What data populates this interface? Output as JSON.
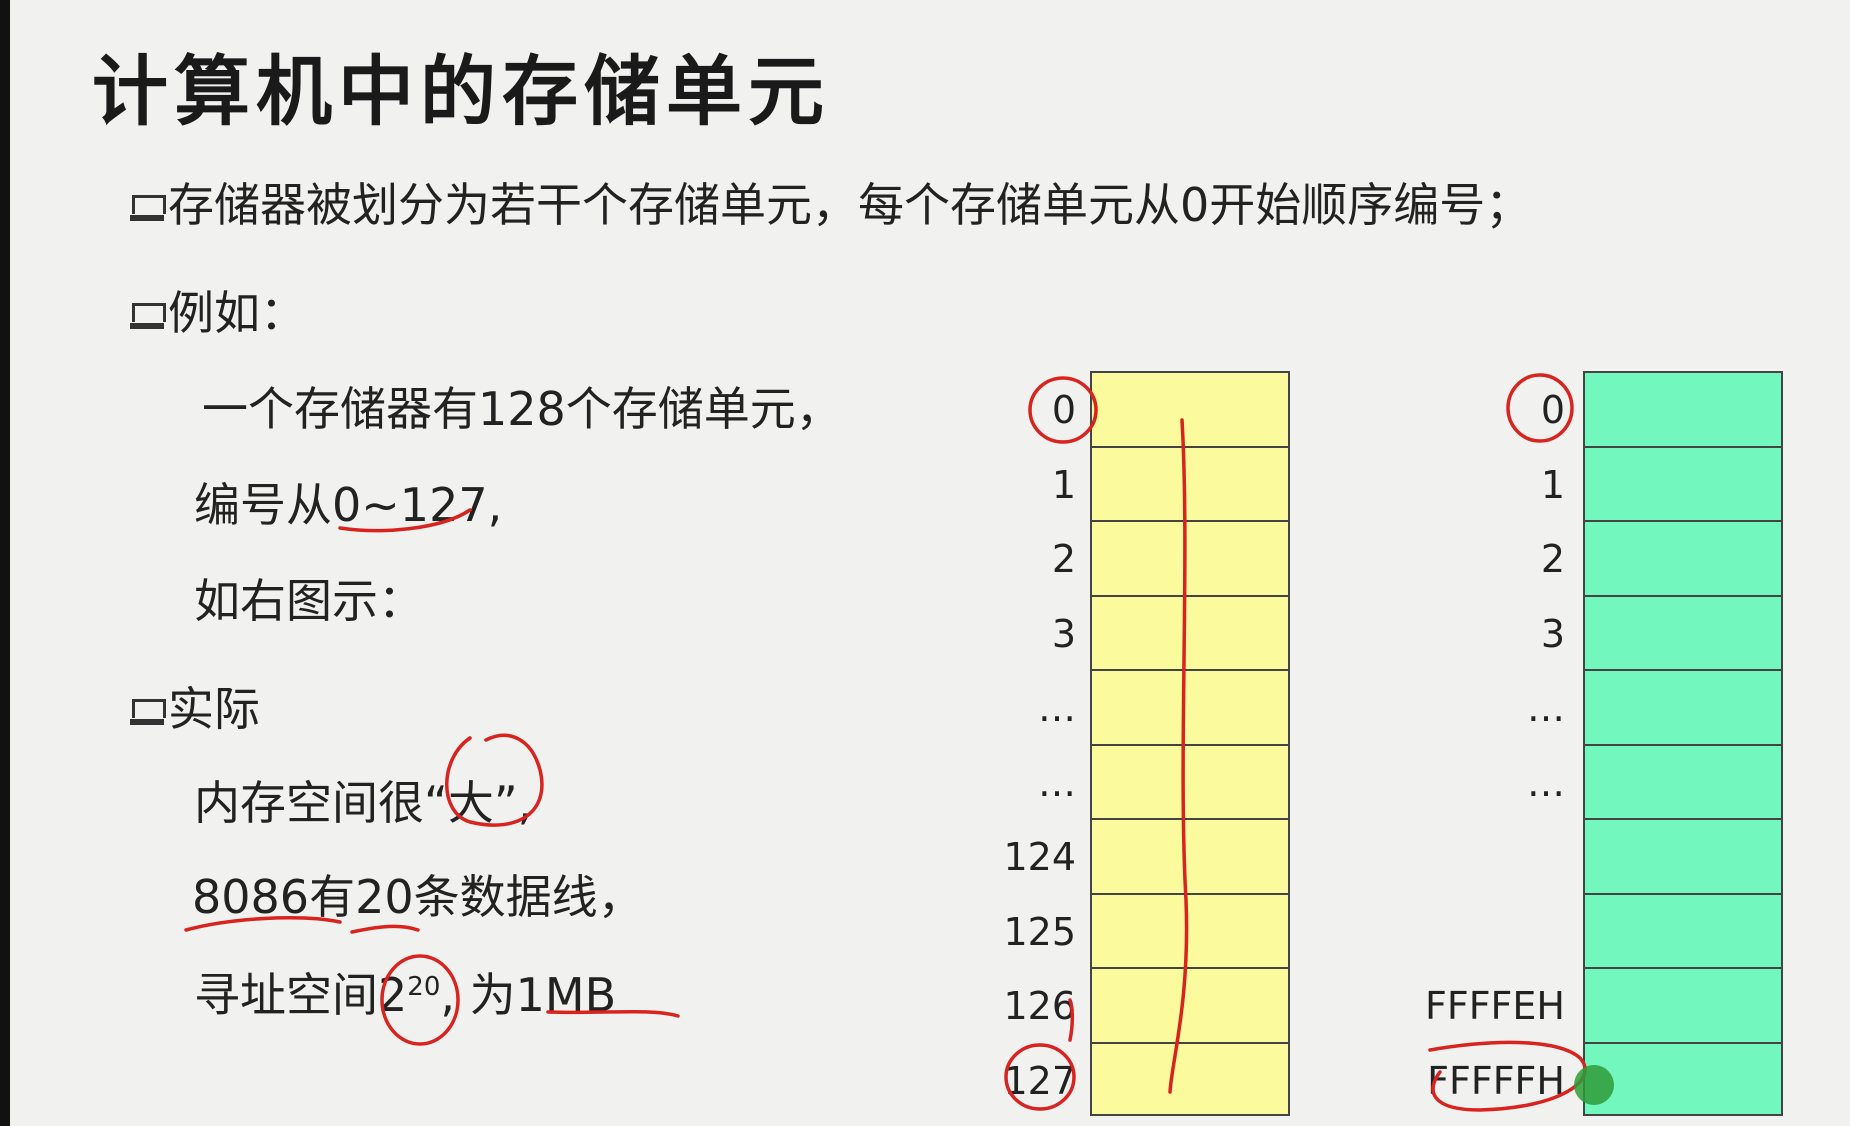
{
  "slide": {
    "title": "计算机中的存储单元",
    "bullet1": "存储器被划分为若干个存储单元，每个存储单元从0开始顺序编号；",
    "bullet2": "例如：",
    "example_line1": "一个存储器有128个存储单元，",
    "example_line2": "编号从0~127,",
    "example_line3": "如右图示：",
    "bullet3": "实际",
    "actual_line1": "内存空间很“大”,",
    "actual_line2": "8086有20条数据线，",
    "actual_line3_prefix": "寻址空间2",
    "actual_line3_exp": "20",
    "actual_line3_suffix": ", 为1MB"
  },
  "diagram_left": {
    "fill_color": "#fbfa9c",
    "addresses": [
      "0",
      "1",
      "2",
      "3",
      "…",
      "…",
      "124",
      "125",
      "126",
      "127"
    ]
  },
  "diagram_right": {
    "fill_color": "#72f7be",
    "addresses": [
      "0",
      "1",
      "2",
      "3",
      "…",
      "…",
      "",
      "",
      "FFFFEH",
      "FFFFFH"
    ]
  },
  "annotation_color": "#d8231e"
}
